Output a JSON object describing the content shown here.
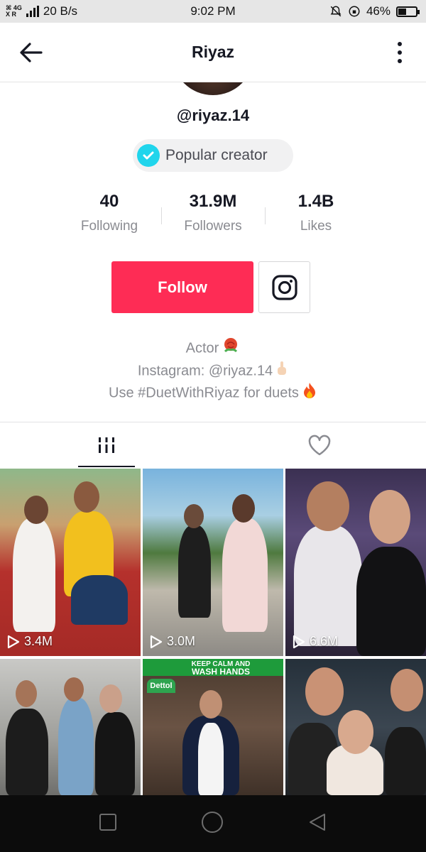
{
  "status_bar": {
    "network_top": "⌘ 4G",
    "network_bottom": "X R",
    "speed": "20 B/s",
    "time": "9:02 PM",
    "battery_text": "46%",
    "battery_level": 0.46
  },
  "header": {
    "title": "Riyaz",
    "back_icon": "arrow-left-icon",
    "more_icon": "more-vertical-icon"
  },
  "profile": {
    "username": "@riyaz.14",
    "badge_label": "Popular creator"
  },
  "stats": [
    {
      "value": "40",
      "label": "Following"
    },
    {
      "value": "31.9M",
      "label": "Followers"
    },
    {
      "value": "1.4B",
      "label": "Likes"
    }
  ],
  "actions": {
    "follow_label": "Follow",
    "instagram_icon": "instagram-icon"
  },
  "bio": {
    "line1": "Actor",
    "line2": "Instagram: @riyaz.14",
    "line3": "Use #DuetWithRiyaz for duets"
  },
  "tabs": [
    {
      "icon": "videos-grid-icon",
      "active": true
    },
    {
      "icon": "heart-icon",
      "active": false
    }
  ],
  "videos": [
    {
      "views": "3.4M"
    },
    {
      "views": "3.0M"
    },
    {
      "views": "6.6M"
    },
    {
      "views": ""
    },
    {
      "views": "",
      "banner_top": "KEEP CALM AND",
      "banner_bottom": "WASH HANDS",
      "brand": "Dettol"
    },
    {
      "views": ""
    }
  ],
  "colors": {
    "accent": "#fe2c55",
    "badge_check": "#20d5ec"
  }
}
